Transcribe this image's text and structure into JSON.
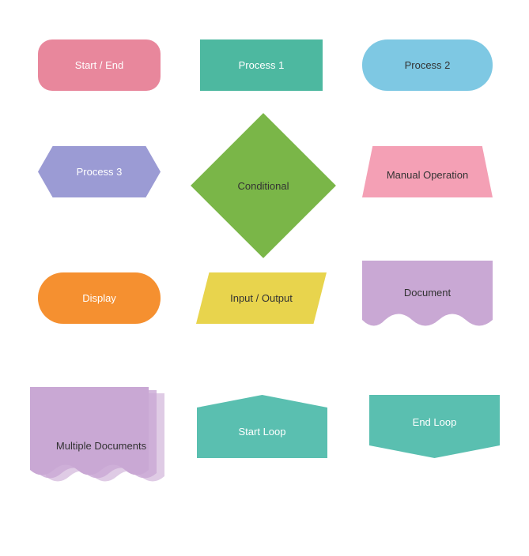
{
  "shapes": {
    "start_end": {
      "label": "Start / End"
    },
    "process1": {
      "label": "Process 1"
    },
    "process2": {
      "label": "Process 2"
    },
    "process3": {
      "label": "Process 3"
    },
    "conditional": {
      "label": "Conditional"
    },
    "manual_op": {
      "label": "Manual Operation"
    },
    "display": {
      "label": "Display"
    },
    "input_output": {
      "label": "Input / Output"
    },
    "document": {
      "label": "Document"
    },
    "multi_doc": {
      "label": "Multiple Documents"
    },
    "start_loop": {
      "label": "Start Loop"
    },
    "end_loop": {
      "label": "End Loop"
    }
  }
}
